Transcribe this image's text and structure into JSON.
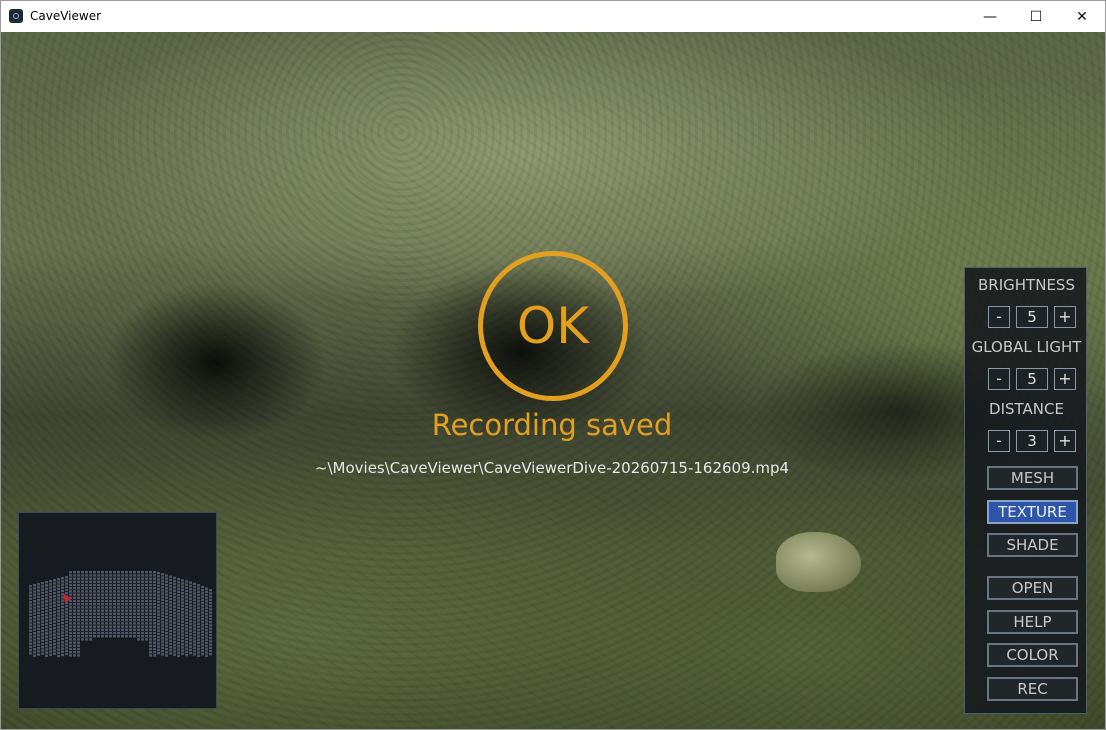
{
  "window": {
    "title": "CaveViewer",
    "minimize": "—",
    "maximize": "☐",
    "close": "✕"
  },
  "overlay": {
    "ok_text": "OK",
    "message": "Recording saved",
    "path": "~\\Movies\\CaveViewer\\CaveViewerDive-20260715-162609.mp4",
    "accent_color": "#e3a020"
  },
  "panel": {
    "brightness": {
      "label": "BRIGHTNESS",
      "minus": "-",
      "value": "5",
      "plus": "+"
    },
    "global_light": {
      "label": "GLOBAL LIGHT",
      "minus": "-",
      "value": "5",
      "plus": "+"
    },
    "distance": {
      "label": "DISTANCE",
      "minus": "-",
      "value": "3",
      "plus": "+"
    },
    "buttons": {
      "mesh": "MESH",
      "texture": "TEXTURE",
      "shade": "SHADE",
      "open": "OPEN",
      "help": "HELP",
      "color": "COLOR",
      "rec": "REC"
    },
    "active_button_color": "#2f55a8"
  },
  "minimap": {
    "map_color": "#4e5463",
    "marker_color": "#c0272d"
  }
}
